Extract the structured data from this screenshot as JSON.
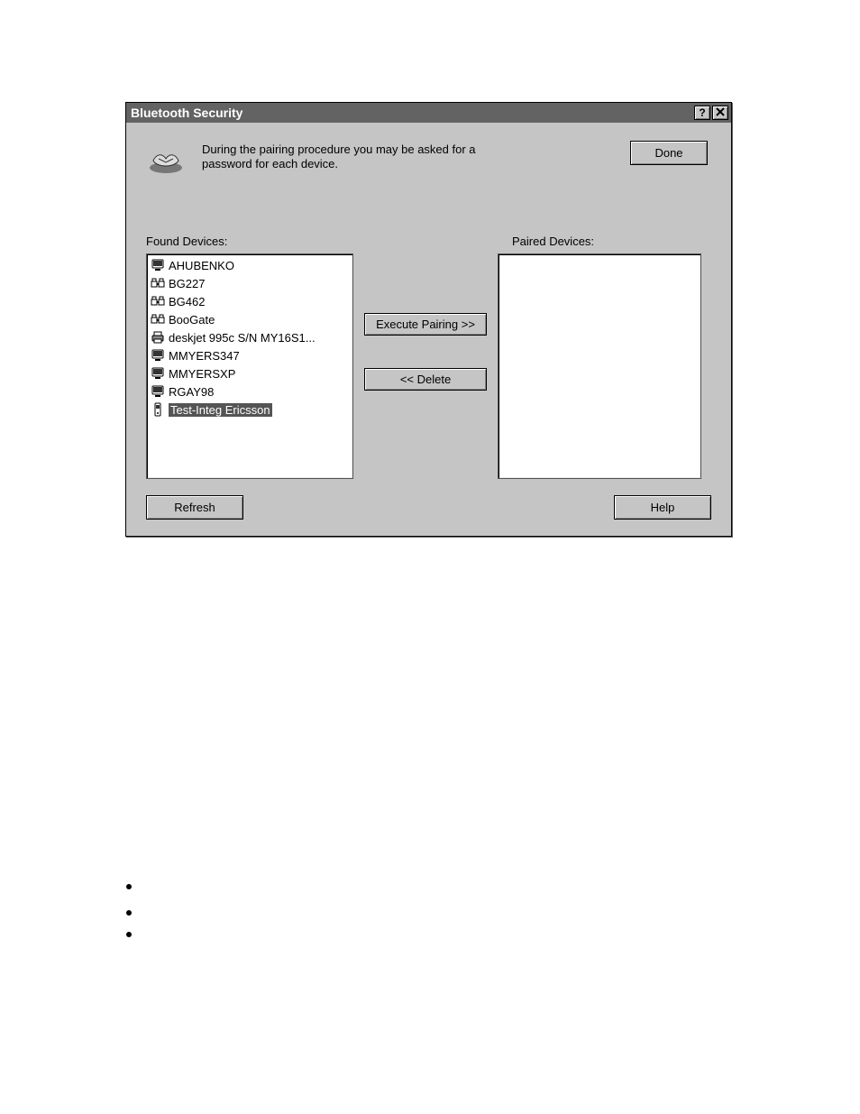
{
  "titlebar": {
    "title": "Bluetooth Security"
  },
  "header": {
    "intro_line1": "During the pairing procedure you may be asked for a",
    "intro_line2": "password for each device.",
    "done_label": "Done"
  },
  "labels": {
    "found": "Found Devices:",
    "paired": "Paired Devices:"
  },
  "buttons": {
    "execute_pairing": "Execute Pairing >>",
    "delete": "<< Delete",
    "refresh": "Refresh",
    "help": "Help"
  },
  "found_devices": [
    {
      "name": "AHUBENKO",
      "icon": "computer",
      "selected": false
    },
    {
      "name": "BG227",
      "icon": "gateway",
      "selected": false
    },
    {
      "name": "BG462",
      "icon": "gateway",
      "selected": false
    },
    {
      "name": "BooGate",
      "icon": "gateway",
      "selected": false
    },
    {
      "name": "deskjet 995c S/N MY16S1...",
      "icon": "printer",
      "selected": false
    },
    {
      "name": "MMYERS347",
      "icon": "computer",
      "selected": false
    },
    {
      "name": "MMYERSXP",
      "icon": "computer",
      "selected": false
    },
    {
      "name": "RGAY98",
      "icon": "computer",
      "selected": false
    },
    {
      "name": "Test-Integ Ericsson",
      "icon": "phone",
      "selected": true
    }
  ],
  "paired_devices": []
}
